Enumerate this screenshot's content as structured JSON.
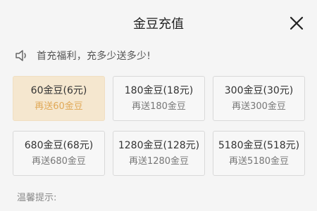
{
  "header": {
    "title": "金豆充值"
  },
  "notice": {
    "text": "首充福利，充多少送多少!"
  },
  "packages": [
    {
      "amount": "60金豆(6元)",
      "bonus": "再送60金豆",
      "selected": true
    },
    {
      "amount": "180金豆(18元)",
      "bonus": "再送180金豆",
      "selected": false
    },
    {
      "amount": "300金豆(30元)",
      "bonus": "再送300金豆",
      "selected": false
    },
    {
      "amount": "680金豆(68元)",
      "bonus": "再送680金豆",
      "selected": false
    },
    {
      "amount": "1280金豆(128元)",
      "bonus": "再送1280金豆",
      "selected": false
    },
    {
      "amount": "5180金豆(518元)",
      "bonus": "再送5180金豆",
      "selected": false
    }
  ],
  "tips": {
    "label": "温馨提示:"
  },
  "colors": {
    "selected_bg": "#f5e7cf",
    "selected_bonus": "#e0a856"
  },
  "icons": {
    "close": "close-icon",
    "notice": "speaker-icon"
  }
}
